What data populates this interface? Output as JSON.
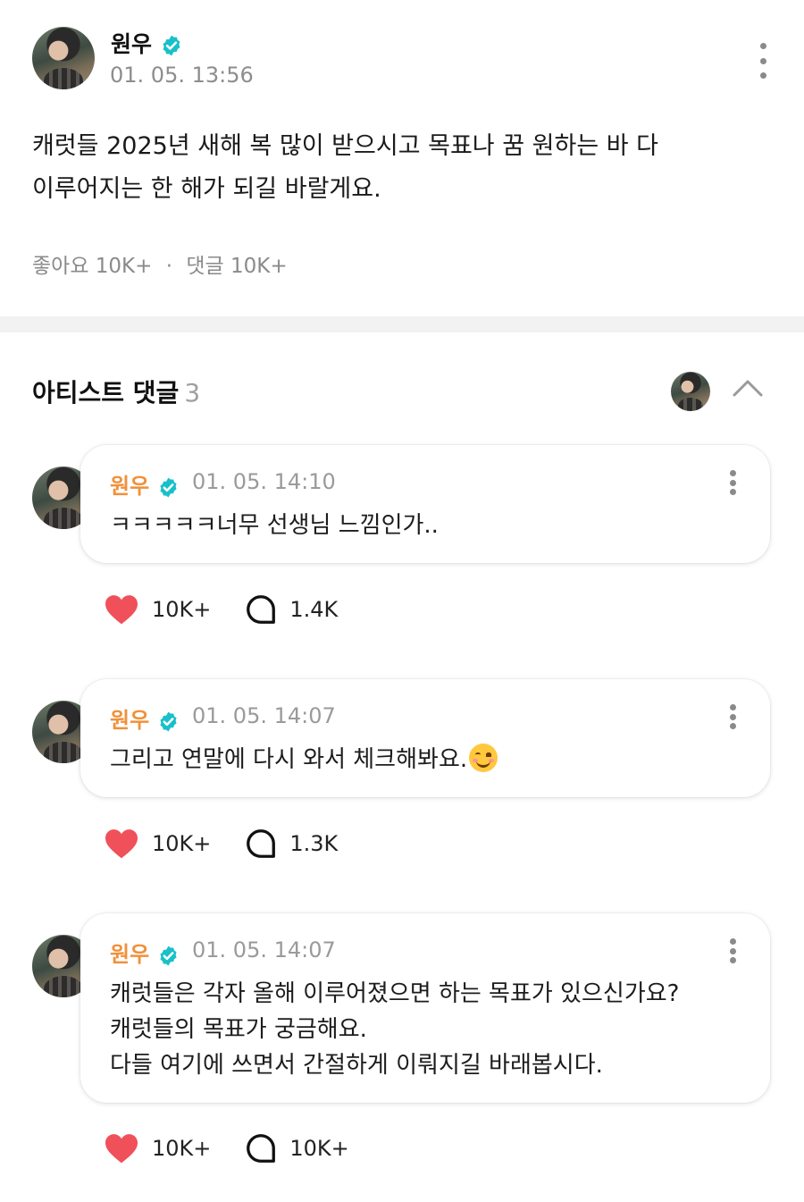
{
  "post": {
    "author": "원우",
    "timestamp": "01. 05. 13:56",
    "text_line1": "캐럿들 2025년 새해 복 많이 받으시고 목표나 꿈 원하는 바 다",
    "text_line2": "이루어지는 한 해가 되길 바랄게요.",
    "likes_label": "좋아요 10K+",
    "separator": "·",
    "comments_label": "댓글 10K+"
  },
  "artist_comments": {
    "title": "아티스트 댓글",
    "count": "3"
  },
  "comments": [
    {
      "author": "원우",
      "timestamp": "01. 05. 14:10",
      "lines": [
        "ㅋㅋㅋㅋㅋ너무 선생님 느낌인가.."
      ],
      "likes": "10K+",
      "replies": "1.4K"
    },
    {
      "author": "원우",
      "timestamp": "01. 05. 14:07",
      "lines": [
        "그리고 연말에 다시 와서 체크해봐요."
      ],
      "emoji": "smiling-face-icon",
      "likes": "10K+",
      "replies": "1.3K"
    },
    {
      "author": "원우",
      "timestamp": "01. 05. 14:07",
      "lines": [
        "캐럿들은 각자 올해 이루어졌으면 하는 목표가 있으신가요?",
        "캐럿들의 목표가 궁금해요.",
        "다들 여기에 쓰면서 간절하게 이뤄지길 바래봅시다."
      ],
      "likes": "10K+",
      "replies": "10K+"
    }
  ],
  "colors": {
    "author_accent": "#f0913a",
    "verified_badge": "#19c0c9",
    "heart": "#f0505a",
    "muted_text": "#8d8d8d"
  }
}
